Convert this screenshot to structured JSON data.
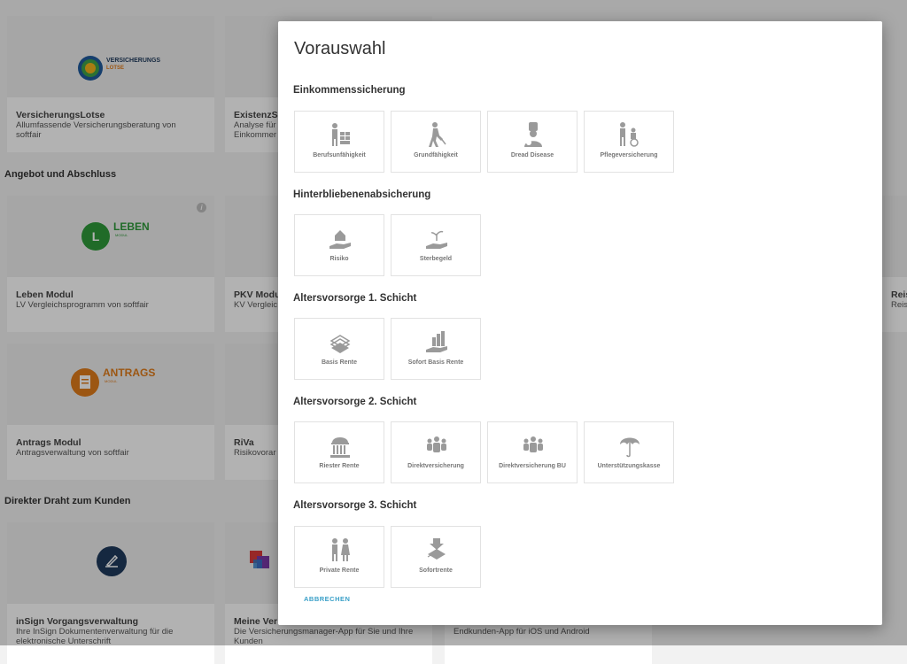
{
  "background": {
    "cards": [
      {
        "title": "VersicherungsLotse",
        "desc": "Allumfassende Versicherungsberatung von softfair"
      },
      {
        "title": "ExistenzSc",
        "desc": "Analyse für\nEinkommer"
      },
      {
        "title": "Leben Modul",
        "desc": "LV Vergleichsprogramm von softfair"
      },
      {
        "title": "PKV Modu",
        "desc": "KV Vergleic"
      },
      {
        "title": "Antrags Modul",
        "desc": "Antragsverwaltung von softfair"
      },
      {
        "title": "RiVa",
        "desc": "Risikovorar"
      },
      {
        "title": "inSign Vorgangsverwaltung",
        "desc": "Ihre InSign Dokumentenverwaltung für die elektronische Unterschrift"
      },
      {
        "title": "Meine Ver",
        "desc": "Die Versicherungsmanager-App für Sie und Ihre Kunden"
      },
      {
        "title": "",
        "desc": "Endkunden-App für iOS und Android"
      },
      {
        "title": "Reis",
        "desc": "Reis"
      }
    ],
    "sections": {
      "angebot": "Angebot und Abschluss",
      "draht": "Direkter Draht zum Kunden"
    },
    "logos": {
      "lotse_line1": "VERSICHERUNGS",
      "lotse_line2": "LOTSE",
      "leben": "LEBEN",
      "leben_sub": "MODUL",
      "leben_letter": "L",
      "antrags": "ANTRAGS",
      "antrags_sub": "MODUL",
      "info": "i"
    }
  },
  "modal": {
    "title": "Vorauswahl",
    "groups": [
      {
        "heading": "Einkommenssicherung",
        "tiles": [
          {
            "label": "Berufsunfähigkeit",
            "icon": "worker-wall-icon"
          },
          {
            "label": "Grundfähigkeit",
            "icon": "walking-person-icon"
          },
          {
            "label": "Dread Disease",
            "icon": "patient-icon"
          },
          {
            "label": "Pflegeversicherung",
            "icon": "wheelchair-care-icon"
          }
        ]
      },
      {
        "heading": "Hinterbliebenenabsicherung",
        "tiles": [
          {
            "label": "Risiko",
            "icon": "house-hand-icon"
          },
          {
            "label": "Sterbegeld",
            "icon": "plant-hand-icon"
          }
        ]
      },
      {
        "heading": "Altersvorsorge 1. Schicht",
        "tiles": [
          {
            "label": "Basis Rente",
            "icon": "money-stack-icon"
          },
          {
            "label": "Sofort Basis Rente",
            "icon": "coins-hand-icon"
          }
        ]
      },
      {
        "heading": "Altersvorsorge 2. Schicht",
        "tiles": [
          {
            "label": "Riester Rente",
            "icon": "government-building-icon"
          },
          {
            "label": "Direktversicherung",
            "icon": "group-people-icon"
          },
          {
            "label": "Direktversicherung BU",
            "icon": "group-people-icon"
          },
          {
            "label": "Unterstützungskasse",
            "icon": "umbrella-icon"
          }
        ]
      },
      {
        "heading": "Altersvorsorge 3. Schicht",
        "tiles": [
          {
            "label": "Private Rente",
            "icon": "elderly-couple-icon"
          },
          {
            "label": "Sofortrente",
            "icon": "money-arrow-icon"
          }
        ]
      }
    ],
    "cancel_label": "ABBRECHEN"
  },
  "colors": {
    "accent": "#3aa0c8",
    "leben_green": "#2e9a3a",
    "antrags_orange": "#e07b1a",
    "insign_navy": "#1f3a5c",
    "icon_gray": "#9a9a9a"
  }
}
